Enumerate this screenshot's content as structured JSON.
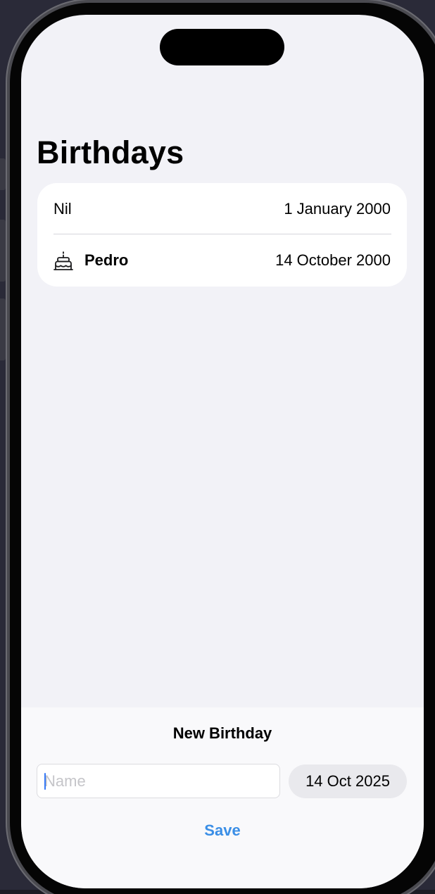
{
  "navigation": {
    "title": "Birthdays"
  },
  "birthdays": [
    {
      "name": "Nil",
      "date": "1 January 2000",
      "is_today": false
    },
    {
      "name": "Pedro",
      "date": "14 October 2000",
      "is_today": true,
      "icon": "birthday-cake-icon"
    }
  ],
  "new_birthday": {
    "title": "New Birthday",
    "name_value": "",
    "name_placeholder": "Name",
    "date_value": "14 Oct 2025",
    "save_label": "Save"
  },
  "colors": {
    "accent": "#3a8ee6",
    "background": "#f2f2f7",
    "card": "#ffffff"
  }
}
